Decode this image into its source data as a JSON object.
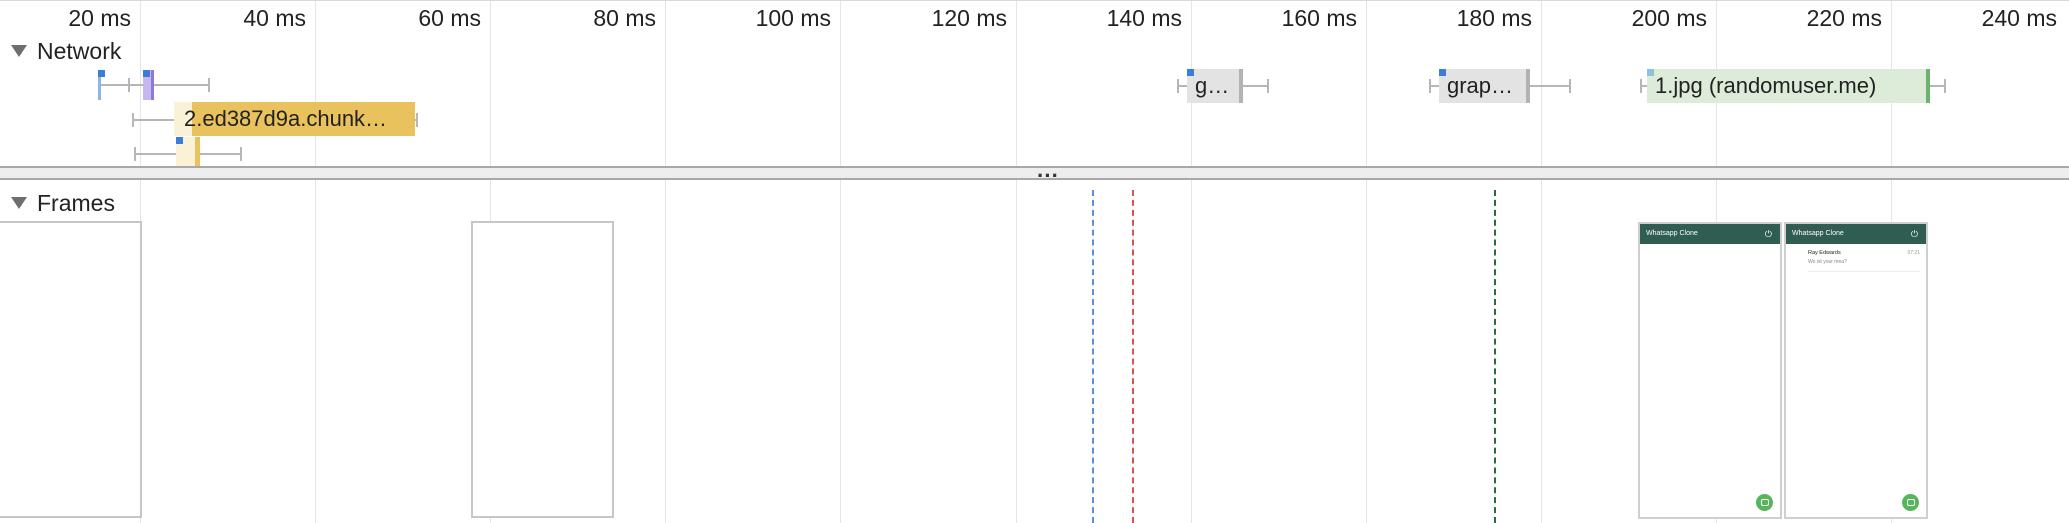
{
  "ruler": {
    "ticks": [
      "20 ms",
      "40 ms",
      "60 ms",
      "80 ms",
      "100 ms",
      "120 ms",
      "140 ms",
      "160 ms",
      "180 ms",
      "200 ms",
      "220 ms",
      "240 ms"
    ]
  },
  "network": {
    "title": "Network",
    "requests": [
      {
        "label": "g…",
        "color": "#e3e3e3"
      },
      {
        "label": "grap…",
        "color": "#e3e3e3"
      },
      {
        "label": "1.jpg (randomuser.me)",
        "color": "#dcecd9"
      },
      {
        "label": "2.ed387d9a.chunk…",
        "color": "#e9c15d"
      }
    ]
  },
  "frames": {
    "title": "Frames",
    "screenshots": [
      {
        "app_title": "Whatsapp Clone"
      },
      {
        "app_title": "Whatsapp Clone",
        "chat": {
          "name": "Ray Edwards",
          "preview": "Wo ist your mea?",
          "time": "07:21"
        }
      }
    ],
    "markers": [
      {
        "color": "#5b8fd6"
      },
      {
        "color": "#d9534f"
      },
      {
        "color": "#2e6b3a"
      }
    ]
  }
}
